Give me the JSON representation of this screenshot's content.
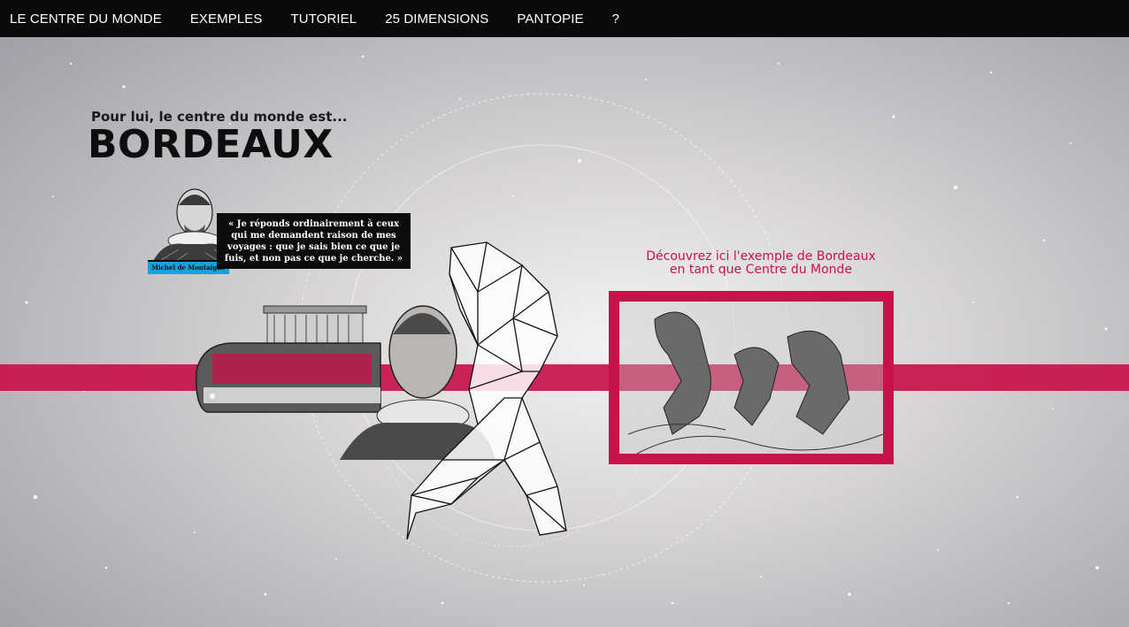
{
  "nav": {
    "items": [
      {
        "label": "LE CENTRE DU MONDE"
      },
      {
        "label": "EXEMPLES"
      },
      {
        "label": "TUTORIEL"
      },
      {
        "label": "25 DIMENSIONS"
      },
      {
        "label": "PANTOPIE"
      },
      {
        "label": "?"
      }
    ]
  },
  "headline": {
    "intro": "Pour lui, le centre du monde est...",
    "city": "BORDEAUX"
  },
  "figure": {
    "name": "Michel de Montaigne",
    "quote": "« Je réponds ordinairement à ceux qui me demandent raison de mes voyages : que je sais bien ce que je fuis, et non pas ce que je cherche. »"
  },
  "discover": {
    "line1": "Découvrez ici l'exemple de Bordeaux",
    "line2": "en tant que Centre du Monde"
  },
  "colors": {
    "accent": "#c8124a",
    "navbar": "#0a0a0a",
    "name_tag": "#1e9fd8"
  }
}
